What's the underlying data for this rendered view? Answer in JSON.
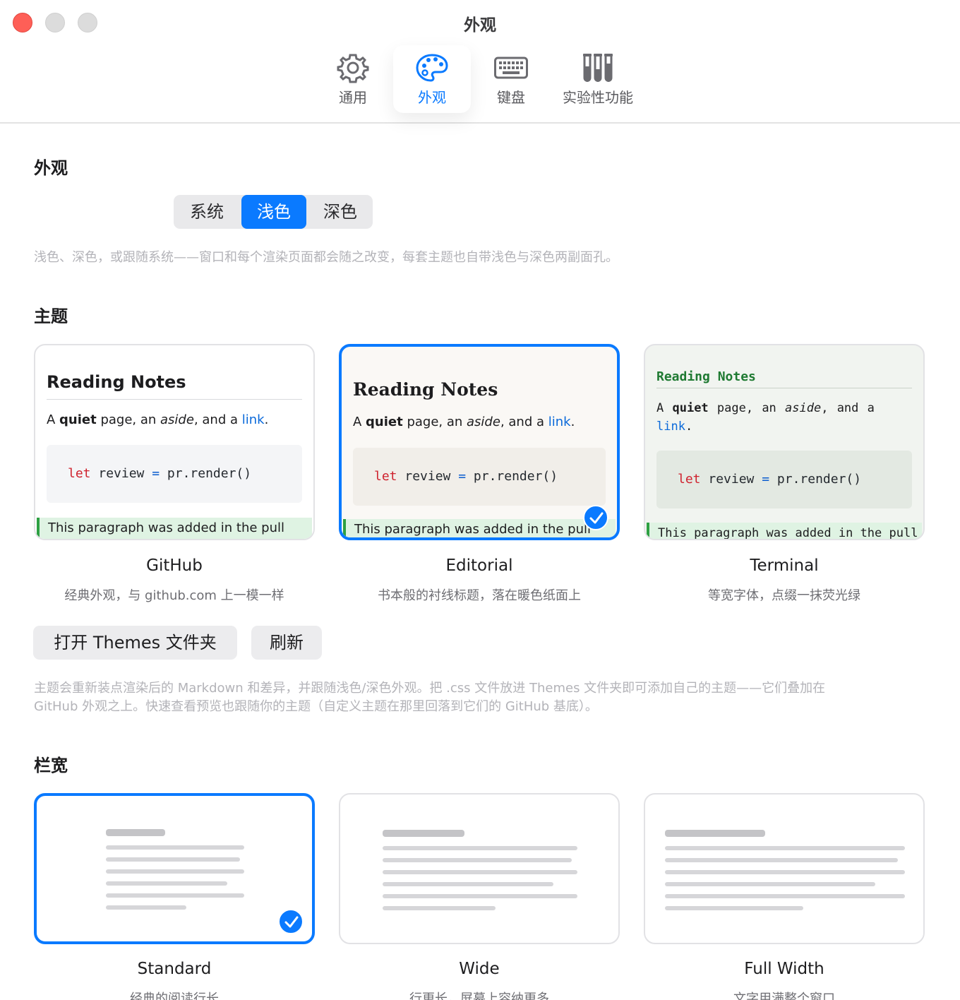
{
  "window": {
    "title": "外观"
  },
  "tabs": [
    {
      "label": "通用",
      "icon": "gear-icon"
    },
    {
      "label": "外观",
      "icon": "palette-icon",
      "active": true
    },
    {
      "label": "键盘",
      "icon": "keyboard-icon"
    },
    {
      "label": "实验性功能",
      "icon": "test-tubes-icon"
    }
  ],
  "appearance": {
    "title": "外观",
    "options": [
      "系统",
      "浅色",
      "深色"
    ],
    "selected": "浅色",
    "hint": "浅色、深色，或跟随系统——窗口和每个渲染页面都会随之改变，每套主题也自带浅色与深色两副面孔。"
  },
  "themes": {
    "title": "主题",
    "preview": {
      "heading": "Reading Notes",
      "para_a": "A ",
      "para_bold": "quiet",
      "para_b": " page, an ",
      "para_italic": "aside",
      "para_c": ", and a ",
      "para_link": "link",
      "para_end": ".",
      "code_kw": "let",
      "code_var": " review ",
      "code_op": "=",
      "code_rest": " pr.render()",
      "diff": "This paragraph was added in the pull"
    },
    "cards": [
      {
        "name": "GitHub",
        "desc": "经典外观，与 github.com 上一模一样"
      },
      {
        "name": "Editorial",
        "desc": "书本般的衬线标题，落在暖色纸面上",
        "selected": true
      },
      {
        "name": "Terminal",
        "desc": "等宽字体，点缀一抹荧光绿"
      }
    ],
    "open_folder_label": "打开 Themes 文件夹",
    "refresh_label": "刷新",
    "hint_line1": "主题会重新装点渲染后的 Markdown 和差异，并跟随浅色/深色外观。把 .css 文件放进 Themes 文件夹即可添加自己的主题——它们叠加在",
    "hint_line2": "GitHub 外观之上。快速查看预览也跟随你的主题（自定义主题在那里回落到它们的 GitHub 基底）。"
  },
  "column_width": {
    "title": "栏宽",
    "options": [
      {
        "name": "Standard",
        "desc": "经典的阅读行长",
        "selected": true
      },
      {
        "name": "Wide",
        "desc": "行更长，屏幕上容纳更多"
      },
      {
        "name": "Full Width",
        "desc": "文字用满整个窗口"
      }
    ]
  },
  "colors": {
    "accent": "#0a7aff",
    "terminal_green": "#1f7a32",
    "diff_green": "#2ea043"
  }
}
